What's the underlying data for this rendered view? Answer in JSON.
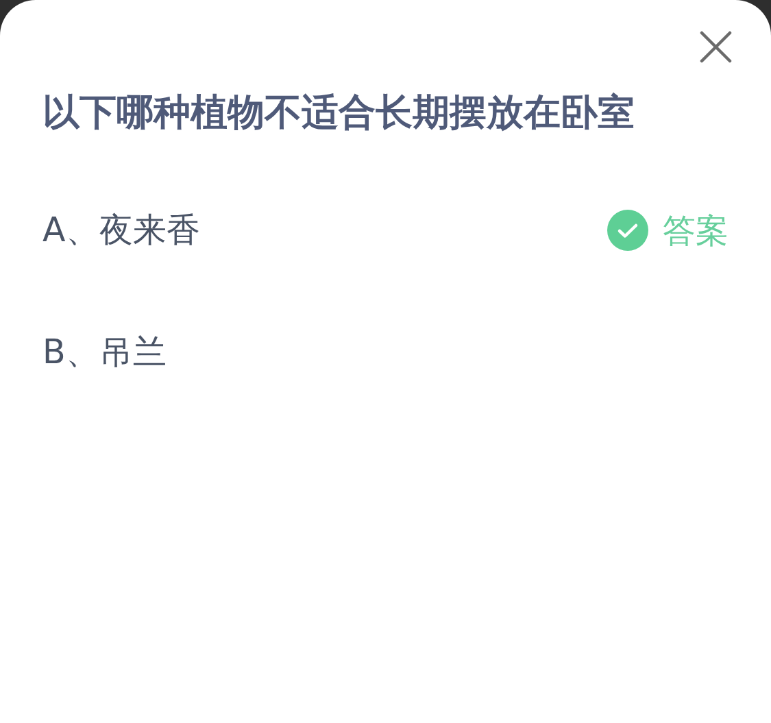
{
  "question": {
    "title": "以下哪种植物不适合长期摆放在卧室"
  },
  "options": [
    {
      "label": "A、夜来香",
      "is_answer": true
    },
    {
      "label": "B、吊兰",
      "is_answer": false
    }
  ],
  "answer_tag": {
    "label": "答案"
  }
}
